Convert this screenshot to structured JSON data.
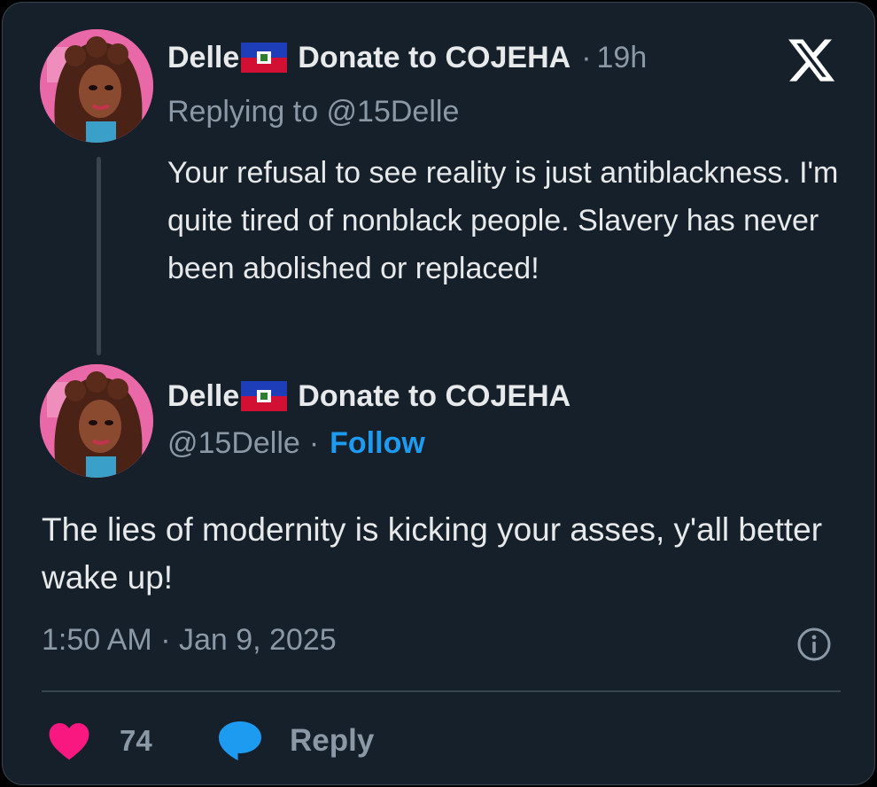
{
  "reply_tweet": {
    "display_name": "Delle",
    "flag_icon": "haiti-flag-icon",
    "name_suffix": "Donate to COJEHA",
    "separator": "·",
    "relative_time": "19h",
    "replying_to": "Replying to @15Delle",
    "text": "Your refusal to see reality is just antiblackness. I'm quite tired of nonblack people. Slavery has never been abolished or replaced!"
  },
  "main_tweet": {
    "display_name": "Delle",
    "flag_icon": "haiti-flag-icon",
    "name_suffix": "Donate to COJEHA",
    "handle": "@15Delle",
    "separator": "·",
    "follow_label": "Follow",
    "text": "The lies of modernity is kicking your asses, y'all better wake up!",
    "timestamp": "1:50 AM · Jan 9, 2025"
  },
  "actions": {
    "like_count": "74",
    "reply_label": "Reply"
  },
  "icons": {
    "logo": "x-logo-icon",
    "info": "info-icon",
    "like": "heart-icon",
    "reply": "speech-bubble-icon"
  },
  "colors": {
    "background": "#15202b",
    "text": "#e7e9ea",
    "muted": "#8b98a5",
    "accent": "#1d9bf0",
    "like": "#f91880",
    "divider": "#38444d"
  }
}
